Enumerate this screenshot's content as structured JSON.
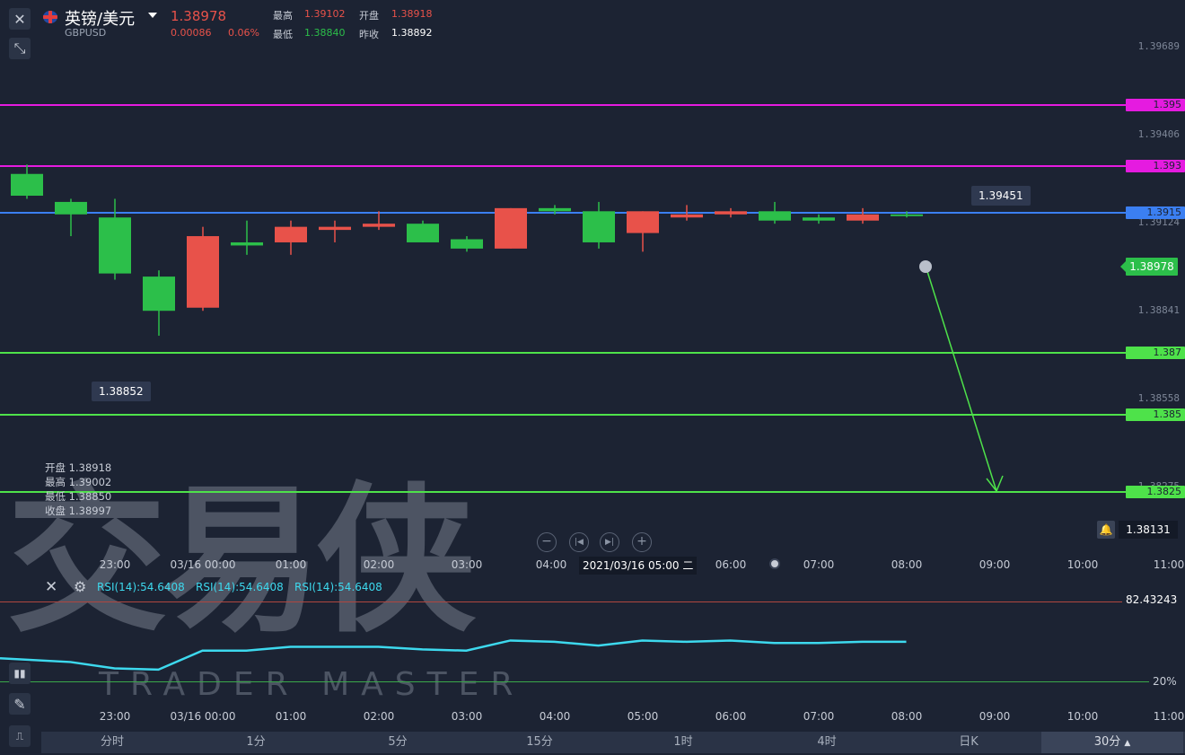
{
  "header": {
    "title": "英镑/美元",
    "symbol": "GBPUSD",
    "price": "1.38978",
    "change": "0.00086",
    "change_pct": "0.06%",
    "quotes": [
      {
        "label": "最高",
        "value": "1.39102",
        "color": "#e8524a"
      },
      {
        "label": "开盘",
        "value": "1.38918",
        "color": "#e8524a"
      },
      {
        "label": "最低",
        "value": "1.38840",
        "color": "#2cbf4a"
      },
      {
        "label": "昨收",
        "value": "1.38892",
        "color": "#ffffff"
      }
    ]
  },
  "price_axis": {
    "ticks": [
      "1.39689",
      "1.39406",
      "1.39124",
      "1.38841",
      "1.38558",
      "1.38275"
    ]
  },
  "hlines": [
    {
      "value": "1.395",
      "color": "#e51be0"
    },
    {
      "value": "1.393",
      "color": "#e51be0"
    },
    {
      "value": "1.3915",
      "color": "#3b7ff2"
    },
    {
      "value": "1.387",
      "color": "#4ee24a"
    },
    {
      "value": "1.385",
      "color": "#4ee24a"
    },
    {
      "value": "1.3825",
      "color": "#4ee24a"
    }
  ],
  "last_price": "1.38978",
  "alert_price": "1.38131",
  "tips": {
    "high": "1.39451",
    "low": "1.38852"
  },
  "ohlc": [
    {
      "label": "开盘",
      "value": "1.38918"
    },
    {
      "label": "最高",
      "value": "1.39002"
    },
    {
      "label": "最低",
      "value": "1.38850"
    },
    {
      "label": "收盘",
      "value": "1.38997"
    }
  ],
  "crosshair_time": "2021/03/16 05:00 二",
  "time_ticks": [
    "23:00",
    "03/16 00:00",
    "01:00",
    "02:00",
    "03:00",
    "04:00",
    "05:00",
    "06:00",
    "07:00",
    "08:00",
    "09:00",
    "10:00",
    "11:00"
  ],
  "rsi": {
    "labels": [
      "RSI(14):54.6408",
      "RSI(14):54.6408",
      "RSI(14):54.6408"
    ],
    "top": "82.43243",
    "bottom": "20%",
    "values": [
      39,
      36,
      31,
      30,
      45,
      45,
      48,
      48,
      48,
      46,
      45,
      53,
      52,
      49,
      53,
      52,
      53,
      51,
      51,
      52,
      52
    ]
  },
  "tabs": [
    "分时",
    "1分",
    "5分",
    "15分",
    "1时",
    "4时",
    "日K",
    "30分"
  ],
  "watermark": {
    "cn": "交易侠",
    "en": "TRADER MASTER"
  },
  "chart_data": {
    "type": "candlestick",
    "series": [
      {
        "open": 1.3928,
        "close": 1.3921,
        "high": 1.3931,
        "low": 1.392,
        "color": "#2cbf4a"
      },
      {
        "open": 1.3919,
        "close": 1.3915,
        "high": 1.392,
        "low": 1.3908,
        "color": "#2cbf4a"
      },
      {
        "open": 1.3914,
        "close": 1.3896,
        "high": 1.392,
        "low": 1.3894,
        "color": "#2cbf4a"
      },
      {
        "open": 1.3895,
        "close": 1.3884,
        "high": 1.3897,
        "low": 1.3876,
        "color": "#2cbf4a"
      },
      {
        "open": 1.3885,
        "close": 1.3908,
        "high": 1.3911,
        "low": 1.3884,
        "color": "#e8524a"
      },
      {
        "open": 1.3906,
        "close": 1.3905,
        "high": 1.3913,
        "low": 1.3902,
        "color": "#2cbf4a"
      },
      {
        "open": 1.3906,
        "close": 1.3911,
        "high": 1.3913,
        "low": 1.3902,
        "color": "#e8524a"
      },
      {
        "open": 1.391,
        "close": 1.3911,
        "high": 1.3913,
        "low": 1.3906,
        "color": "#e8524a"
      },
      {
        "open": 1.3911,
        "close": 1.3912,
        "high": 1.3916,
        "low": 1.391,
        "color": "#e8524a"
      },
      {
        "open": 1.3912,
        "close": 1.3906,
        "high": 1.3913,
        "low": 1.3906,
        "color": "#2cbf4a"
      },
      {
        "open": 1.3907,
        "close": 1.3904,
        "high": 1.3908,
        "low": 1.3903,
        "color": "#2cbf4a"
      },
      {
        "open": 1.3904,
        "close": 1.3917,
        "high": 1.3917,
        "low": 1.3904,
        "color": "#e8524a"
      },
      {
        "open": 1.3917,
        "close": 1.3916,
        "high": 1.3918,
        "low": 1.3915,
        "color": "#2cbf4a"
      },
      {
        "open": 1.3916,
        "close": 1.3906,
        "high": 1.3919,
        "low": 1.3904,
        "color": "#2cbf4a"
      },
      {
        "open": 1.3909,
        "close": 1.3916,
        "high": 1.3916,
        "low": 1.3903,
        "color": "#e8524a"
      },
      {
        "open": 1.3914,
        "close": 1.3915,
        "high": 1.3918,
        "low": 1.3913,
        "color": "#e8524a"
      },
      {
        "open": 1.3915,
        "close": 1.3916,
        "high": 1.3917,
        "low": 1.3914,
        "color": "#e8524a"
      },
      {
        "open": 1.3916,
        "close": 1.3913,
        "high": 1.3919,
        "low": 1.3912,
        "color": "#2cbf4a"
      },
      {
        "open": 1.3914,
        "close": 1.3913,
        "high": 1.3915,
        "low": 1.3912,
        "color": "#2cbf4a"
      },
      {
        "open": 1.3913,
        "close": 1.3915,
        "high": 1.3917,
        "low": 1.3912,
        "color": "#e8524a"
      },
      {
        "open": 1.3915,
        "close": 1.3915,
        "high": 1.3916,
        "low": 1.3914,
        "color": "#2cbf4a"
      }
    ]
  }
}
